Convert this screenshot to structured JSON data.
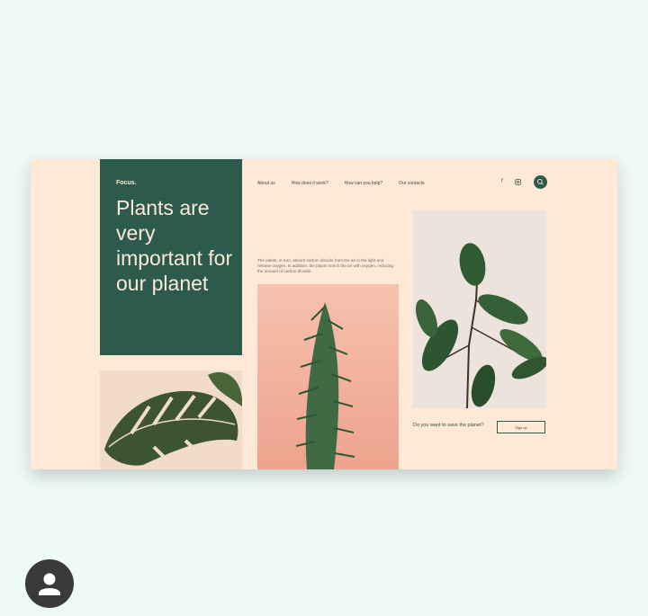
{
  "site": {
    "brand": "Focus.",
    "headline": "Plants are very important for our planet",
    "nav": [
      "About us",
      "How does it work?",
      "How can you help?",
      "Our contacts"
    ],
    "social_icons": [
      "facebook-icon",
      "instagram-icon",
      "search-icon"
    ],
    "description": "The plants, in turn, absorb carbon dioxide from the air in the light and release oxygen. In addition, the plants enrich the air with oxygen, reducing the amount of carbon dioxide.",
    "cta_question": "Do you want to save the planet?",
    "cta_button": "Sign up"
  },
  "colors": {
    "page_background": "#eefaf7",
    "card_background": "#fde9d6",
    "accent_green": "#2c5a4d",
    "pink_panel": "#f0a893"
  },
  "profile": {
    "icon": "user-avatar-icon"
  }
}
